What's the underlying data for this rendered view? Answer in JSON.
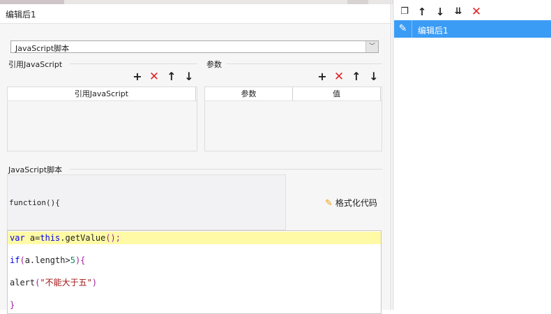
{
  "editor": {
    "title": "编辑后1",
    "script_type": "JavaScript脚本",
    "ref_group_label": "引用JavaScript",
    "param_group_label": "参数",
    "ref_table": {
      "headers": [
        "引用JavaScript"
      ]
    },
    "param_table": {
      "headers": [
        "参数",
        "值"
      ]
    },
    "js_group_label": "JavaScript脚本",
    "function_header": "function(){",
    "format_button": "格式化代码",
    "code": {
      "line1": {
        "kw": "var",
        "a": " a=",
        "this": "this",
        "call": ".getValue",
        "paren": "();"
      },
      "line2": {
        "kw": "if",
        "p1": "(",
        "cond": "a.length>",
        "num": "5",
        "p2": "){"
      },
      "line3": {
        "fn": "alert",
        "p1": "(",
        "str": "\"不能大于五\"",
        "p2": ")"
      },
      "line4": "}"
    }
  },
  "right": {
    "items": [
      {
        "label": "编辑后1",
        "selected": true
      }
    ]
  },
  "colors": {
    "accent": "#3b9cf5",
    "delete": "#e02424",
    "highlight_line": "#fffaa6"
  },
  "icons": [
    "copy-icon",
    "arrow-up-icon",
    "arrow-down-icon",
    "move-bottom-icon",
    "delete-icon",
    "add-icon",
    "edit-icon",
    "broom-icon",
    "dropdown-arrow-icon"
  ]
}
